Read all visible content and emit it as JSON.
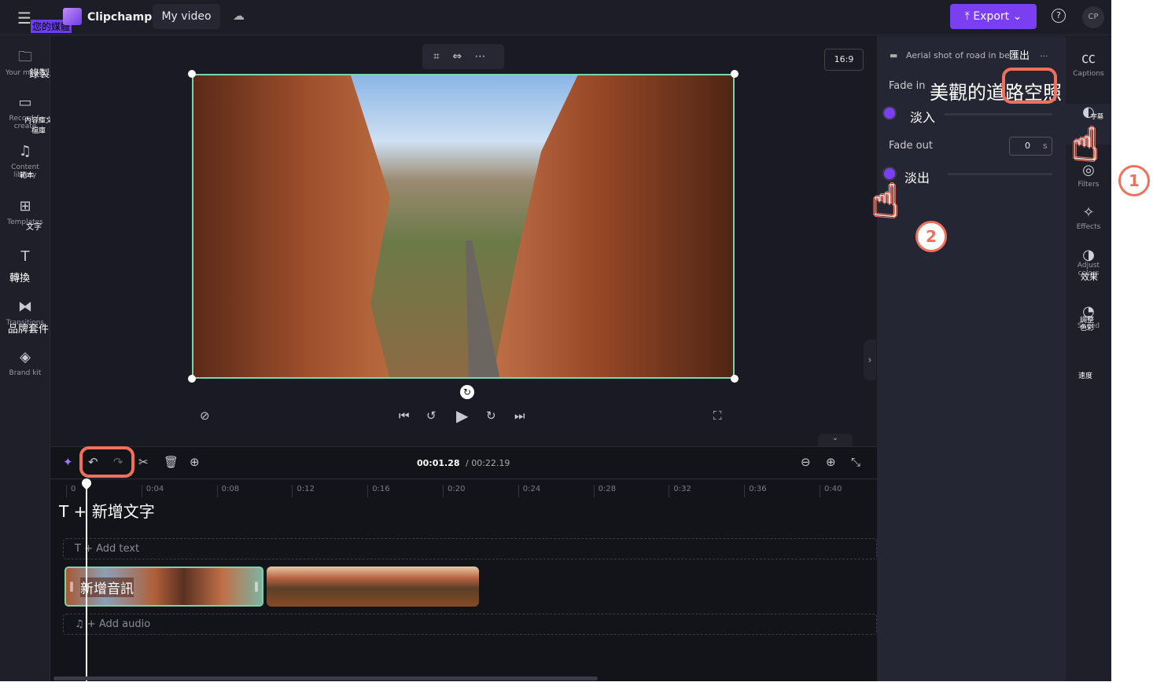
{
  "topbar": {
    "app_name": "Clipchamp",
    "project_title": "My video",
    "export_label": "Export",
    "avatar": "CP",
    "menu_overlay": "您的媒體"
  },
  "sidebar": {
    "items": [
      {
        "label": "Your media",
        "overlay": "錄製和",
        "icon": "folder-icon"
      },
      {
        "label": "Record & create",
        "overlay": "內容庫文\n檔庫",
        "icon": "camera-icon"
      },
      {
        "label": "Content library",
        "overlay": "範本",
        "icon": "content-library-icon"
      },
      {
        "label": "Templates",
        "overlay": "文字",
        "icon": "templates-icon"
      },
      {
        "label": "Text",
        "overlay": "轉換",
        "icon": "text-icon"
      },
      {
        "label": "Transitions",
        "overlay": "品牌套件",
        "icon": "transitions-icon"
      },
      {
        "label": "Brand kit",
        "overlay": "",
        "icon": "brand-kit-icon"
      }
    ]
  },
  "preview": {
    "aspect_ratio": "16:9"
  },
  "timeline": {
    "current_time": "00:01.28",
    "total_time": "/ 00:22.19",
    "ticks": [
      "0",
      "0:04",
      "0:08",
      "0:12",
      "0:16",
      "0:20",
      "0:24",
      "0:28",
      "0:32",
      "0:36",
      "0:40"
    ],
    "add_text": "+ Add text",
    "add_text_overlay": "T + 新增文字",
    "add_audio": "+ Add audio",
    "clip_overlay": "新增音訊"
  },
  "panel": {
    "clip_title": "Aerial shot of road in be",
    "clip_title_overlay": "匯出",
    "title_overlay": "美觀的道路空照",
    "fade_in_label": "Fade in",
    "fade_in_overlay": "淡入",
    "fade_out_label": "Fade out",
    "fade_out_overlay": "淡出",
    "fade_out_value": "0",
    "unit": "s",
    "more": "..."
  },
  "rightstrip": {
    "items": [
      {
        "label": "Captions",
        "overlay": ""
      },
      {
        "label": "Fade",
        "overlay": "字幕"
      },
      {
        "label": "Filters",
        "overlay": ""
      },
      {
        "label": "Effects",
        "overlay": ""
      },
      {
        "label": "Adjust colors",
        "overlay": "效果"
      },
      {
        "label": "Speed",
        "overlay": "調整色彩"
      },
      {
        "label": "",
        "overlay": "速度"
      }
    ]
  },
  "annotations": {
    "step1": "1",
    "step2": "2"
  },
  "colors": {
    "accent": "#7b3ff2",
    "highlight": "#f0705c",
    "selection": "#7fd1a9"
  }
}
